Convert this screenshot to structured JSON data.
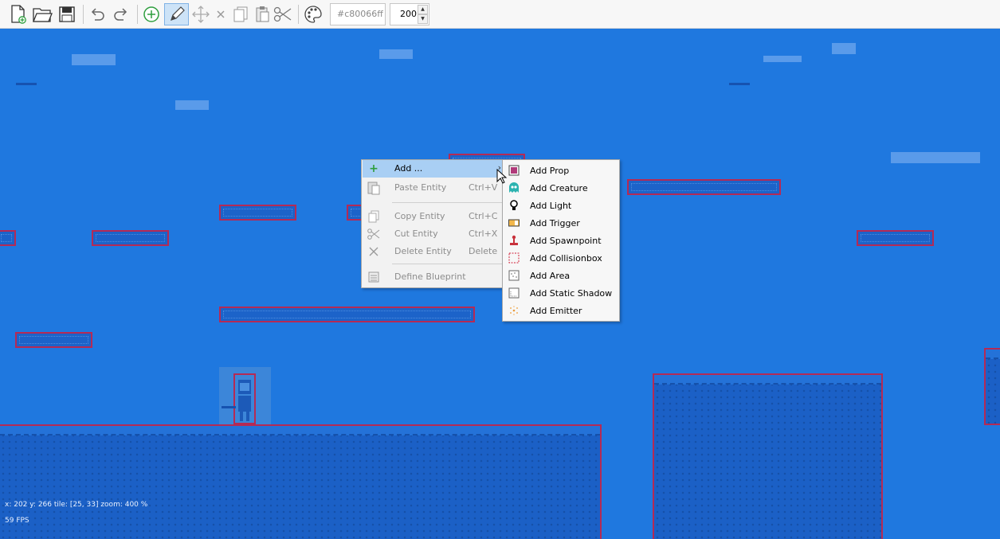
{
  "toolbar": {
    "color_value": "#c80066ff",
    "size_value": "200",
    "spin_up": "▲",
    "spin_down": "▼",
    "icons": [
      "new-file-icon",
      "open-folder-icon",
      "save-icon",
      "undo-icon",
      "redo-icon",
      "add-entity-icon",
      "edit-pencil-icon",
      "move-icon",
      "delete-icon",
      "copy-icon",
      "paste-icon",
      "cut-icon",
      "palette-icon"
    ]
  },
  "hud": {
    "position": "x: 202 y: 266 tile: [25, 33] zoom: 400 %",
    "fps": "59 FPS"
  },
  "context_menu": {
    "add": {
      "label": "Add ...",
      "arrow": "›"
    },
    "paste": {
      "label": "Paste Entity",
      "shortcut": "Ctrl+V"
    },
    "copy": {
      "label": "Copy Entity",
      "shortcut": "Ctrl+C"
    },
    "cut": {
      "label": "Cut Entity",
      "shortcut": "Ctrl+X"
    },
    "delete": {
      "label": "Delete Entity",
      "shortcut": "Delete"
    },
    "blueprint": {
      "label": "Define Blueprint"
    }
  },
  "submenu": {
    "items": [
      {
        "label": "Add Prop",
        "icon": "prop-icon"
      },
      {
        "label": "Add Creature",
        "icon": "creature-icon"
      },
      {
        "label": "Add Light",
        "icon": "light-bulb-icon"
      },
      {
        "label": "Add Trigger",
        "icon": "trigger-icon"
      },
      {
        "label": "Add Spawnpoint",
        "icon": "spawnpoint-icon"
      },
      {
        "label": "Add Collisionbox",
        "icon": "collisionbox-icon"
      },
      {
        "label": "Add Area",
        "icon": "area-icon"
      },
      {
        "label": "Add Static Shadow",
        "icon": "static-shadow-icon"
      },
      {
        "label": "Add Emitter",
        "icon": "emitter-icon"
      }
    ]
  },
  "colors": {
    "canvas_bg": "#1f78df",
    "collision_border": "#b52a55",
    "menu_highlight": "#a9cff4"
  }
}
